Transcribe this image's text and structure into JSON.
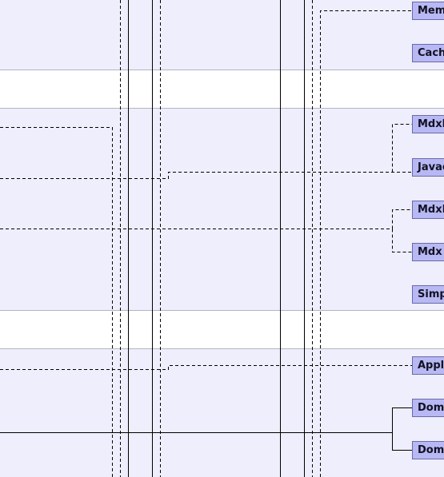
{
  "nodes": [
    {
      "id": "mem",
      "label": "Mem"
    },
    {
      "id": "cach",
      "label": "Cach"
    },
    {
      "id": "mdxb",
      "label": "Mdxb"
    },
    {
      "id": "javac",
      "label": "Javac"
    },
    {
      "id": "mdxe",
      "label": "MdxE"
    },
    {
      "id": "mdx",
      "label": "Mdx"
    },
    {
      "id": "simp",
      "label": "Simp"
    },
    {
      "id": "appl",
      "label": "Appl"
    },
    {
      "id": "dom1",
      "label": "Dom"
    },
    {
      "id": "dom2",
      "label": "Dom"
    }
  ]
}
